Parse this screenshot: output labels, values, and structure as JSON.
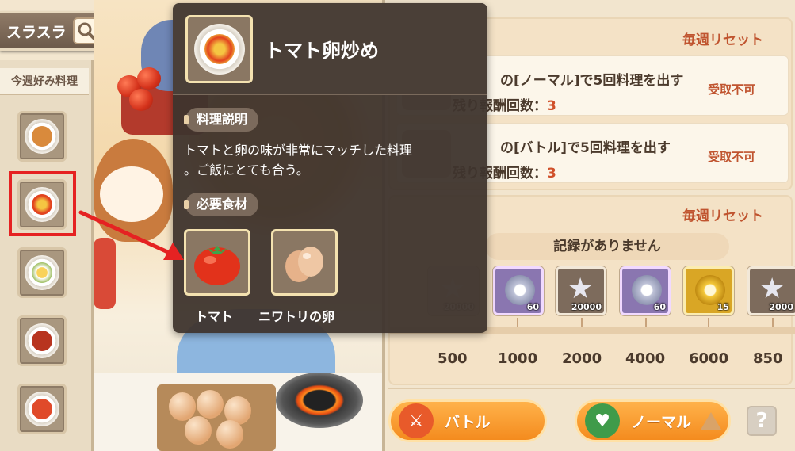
{
  "search": {
    "label": "スラスラ",
    "icon": "search-icon"
  },
  "weekly": {
    "title": "今週好み料理",
    "dishes": [
      {
        "name": "noodle-dish",
        "color": "#d98a3c"
      },
      {
        "name": "tomato-egg-dish",
        "color": "#e2431f",
        "selected": true
      },
      {
        "name": "egg-rice-dish",
        "color": "#f1c54a"
      },
      {
        "name": "chili-meat-dish",
        "color": "#b8341f"
      },
      {
        "name": "tomato-noodle-dish",
        "color": "#e04a2a"
      }
    ]
  },
  "tooltip": {
    "title": "トマト卵炒め",
    "desc_label": "料理説明",
    "description": "トマトと卵の味が非常にマッチした料理\n。ご飯にとても合う。",
    "ingredients_label": "必要食材",
    "ingredients": [
      {
        "label": "トマト",
        "icon": "tomato-icon"
      },
      {
        "label": "ニワトリの卵",
        "icon": "egg-icon"
      }
    ]
  },
  "missions": {
    "reset_label": "毎週リセット",
    "items": [
      {
        "text": "[ノーマル]で5回料理を出す",
        "prefix": "の",
        "remain_label": "報酬回数：",
        "remain_value": "3",
        "status": "受取不可",
        "partial": "残り"
      },
      {
        "text": "[バトル]で5回料理を出す",
        "prefix": "の",
        "remain_label": "報酬回数：",
        "remain_value": "3",
        "status": "受取不可",
        "partial": "残り"
      }
    ]
  },
  "rewards": {
    "reset_label": "毎週リセット",
    "no_record": "記録がありません",
    "items": [
      {
        "type": "dim",
        "icon": "star-icon",
        "count": "20000"
      },
      {
        "type": "purple",
        "icon": "chef-hat-coin-icon",
        "count": "60"
      },
      {
        "type": "normal",
        "icon": "star-icon",
        "count": "20000"
      },
      {
        "type": "purple",
        "icon": "chef-hat-coin-icon",
        "count": "60"
      },
      {
        "type": "gold",
        "icon": "gold-chef-coin-icon",
        "count": "15"
      },
      {
        "type": "normal",
        "icon": "star-icon",
        "count": "2000"
      }
    ],
    "milestones": [
      "500",
      "1000",
      "2000",
      "4000",
      "6000",
      "850"
    ]
  },
  "buttons": {
    "battle": "バトル",
    "normal": "ノーマル",
    "help": "?"
  },
  "colors": {
    "accent": "#f48b1e",
    "highlight": "#e52222",
    "reset_text": "#c0542f"
  }
}
